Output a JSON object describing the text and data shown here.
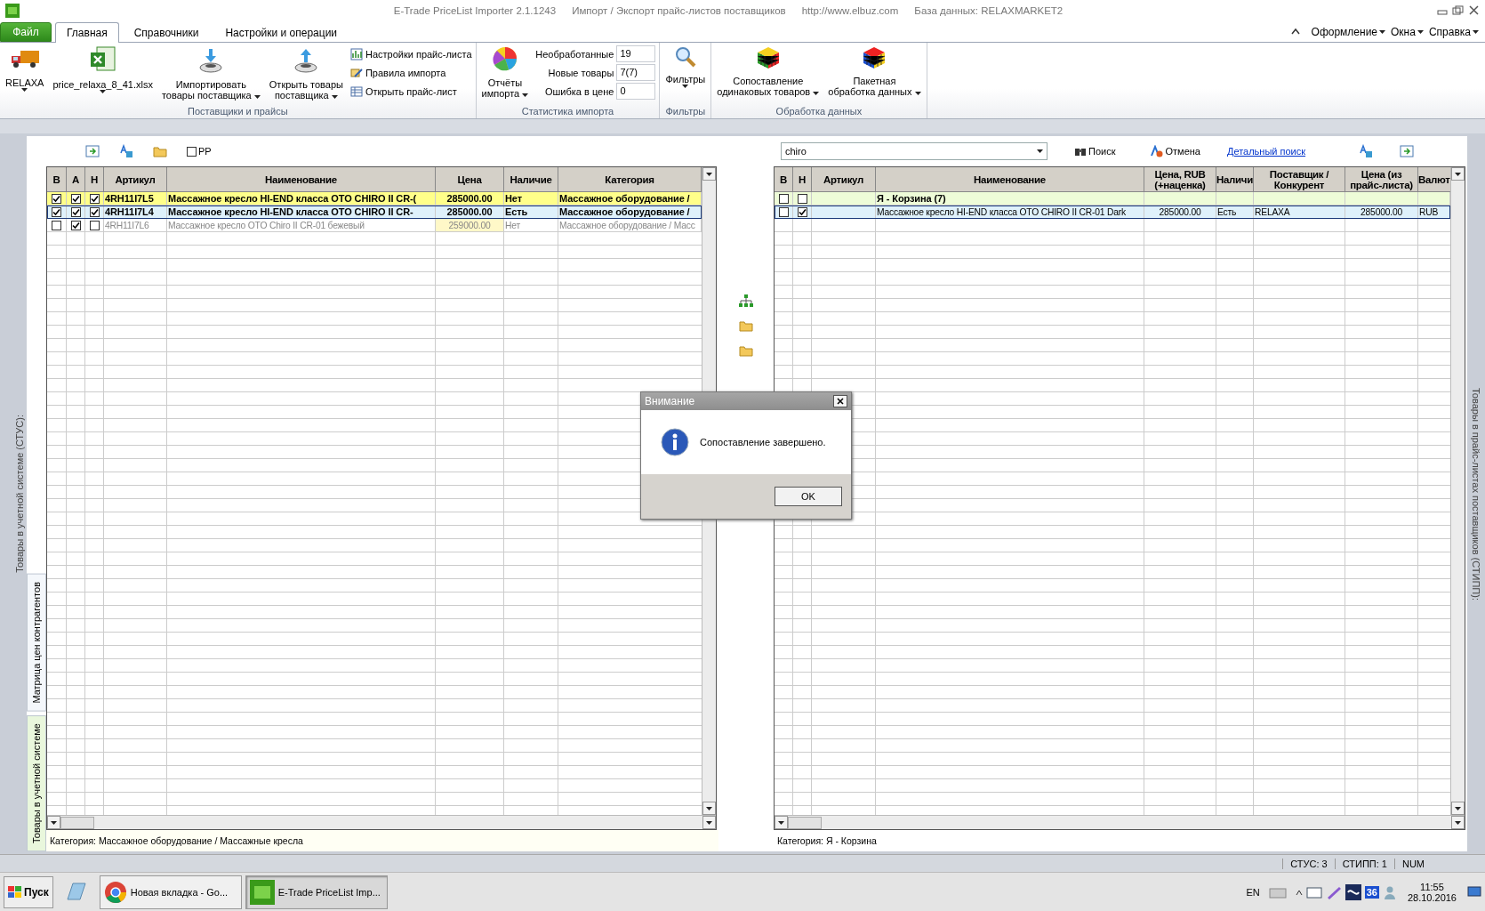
{
  "window": {
    "title_parts": [
      "E-Trade PriceList Importer 2.1.1243",
      "Импорт / Экспорт прайс-листов поставщиков",
      "http://www.elbuz.com",
      "База данных: RELAXMARKET2"
    ]
  },
  "ribbon_tabs": [
    {
      "label": "Файл",
      "kind": "file",
      "selected": false
    },
    {
      "label": "Главная",
      "kind": "tab",
      "selected": true
    },
    {
      "label": "Справочники",
      "kind": "tab",
      "selected": false
    },
    {
      "label": "Настройки и операции",
      "kind": "tab",
      "selected": false
    }
  ],
  "top_menu": [
    {
      "label": "Оформление",
      "dropdown": true
    },
    {
      "label": "Окна",
      "dropdown": true
    },
    {
      "label": "Справка",
      "dropdown": true
    }
  ],
  "ribbon_groups": [
    {
      "title": "Поставщики и прайсы",
      "items": [
        {
          "kind": "large",
          "lines": [
            "RELAXA"
          ],
          "dropdown": true
        },
        {
          "kind": "large",
          "lines": [
            "price_relaxa_8_41.xlsx"
          ],
          "dropdown": true
        },
        {
          "kind": "large",
          "lines": [
            "Импортировать",
            "товары поставщика"
          ],
          "dropdown": true
        },
        {
          "kind": "large",
          "lines": [
            "Открыть товары",
            "поставщика"
          ],
          "dropdown": true
        },
        {
          "kind": "small",
          "lines": [
            "Настройки прайс-листа",
            "Правила импорта",
            "Открыть прайс-лист"
          ]
        }
      ]
    },
    {
      "title": "Статистика импорта",
      "items": [
        {
          "kind": "large",
          "lines": [
            "Отчёты",
            "импорта"
          ],
          "dropdown": true
        },
        {
          "kind": "stats",
          "stats": [
            {
              "label": "Необработанные",
              "value": "19"
            },
            {
              "label": "Новые товары",
              "value": "7(7)"
            },
            {
              "label": "Ошибка в цене",
              "value": "0"
            }
          ]
        }
      ]
    },
    {
      "title": "Фильтры",
      "items": [
        {
          "kind": "large",
          "lines": [
            "Фильтры"
          ],
          "dropdown": true
        }
      ]
    },
    {
      "title": "Обработка данных",
      "items": [
        {
          "kind": "large",
          "lines": [
            "Сопоставление",
            "одинаковых товаров"
          ],
          "dropdown": true
        },
        {
          "kind": "large",
          "lines": [
            "Пакетная",
            "обработка данных"
          ],
          "dropdown": true
        }
      ]
    }
  ],
  "left_caption": "Товары в учетной системе (СТУС):",
  "side_tabs": [
    {
      "label": "Матрица цен контрагентов",
      "selected": false
    },
    {
      "label": "Товары в учетной системе",
      "selected": true
    }
  ],
  "right_caption": "Товары в прайс-листах поставщиков (СТИПП):",
  "left_toolbar": {
    "pp_checkbox": {
      "label": "PP",
      "checked": false
    }
  },
  "search": {
    "value": "chiro",
    "buttons": [
      "Поиск",
      "Отмена"
    ],
    "link": "Детальный поиск"
  },
  "left_table": {
    "check_columns": [
      "В",
      "А",
      "Н"
    ],
    "columns": [
      "Артикул",
      "Наименование",
      "Цена",
      "Наличие",
      "Категория"
    ],
    "rows": [
      {
        "kind": "highlight",
        "selected": false,
        "b": true,
        "a": true,
        "n": true,
        "cells": [
          "4RH11I7L5",
          "Массажное кресло HI-END класса OTO CHIRO II CR-(",
          "285000.00",
          "Нет",
          "Массажное оборудование /"
        ]
      },
      {
        "kind": "highlight",
        "selected": true,
        "b": true,
        "a": true,
        "n": true,
        "cells": [
          "4RH11I7L4",
          "Массажное кресло HI-END класса OTO CHIRO II CR-",
          "285000.00",
          "Есть",
          "Массажное оборудование /"
        ]
      },
      {
        "kind": "inactive",
        "selected": false,
        "b": false,
        "a": true,
        "n": false,
        "cells": [
          "4RH11I7L6",
          "Массажное кресло OTO Chiro II CR-01 бежевый",
          "259000.00",
          "Нет",
          "Массажное оборудование / Масс"
        ]
      }
    ],
    "footer": "Категория: Массажное оборудование / Массажные кресла"
  },
  "right_table": {
    "check_columns": [
      "В",
      "Н"
    ],
    "columns": [
      "Артикул",
      "Наименование",
      "Цена, RUB (+наценка)",
      "Наличи",
      "Поставщик / Конкурент",
      "Цена (из прайс-листа)",
      "Валют"
    ],
    "rows": [
      {
        "kind": "group",
        "selected": false,
        "b": false,
        "n": false,
        "cells": [
          "",
          "Я - Корзина (7)"
        ]
      },
      {
        "kind": "normal",
        "selected": true,
        "b": false,
        "n": true,
        "cells": [
          "",
          "Массажное кресло HI-END класса OTO CHIRO II CR-01 Dark",
          "285000.00",
          "Есть",
          "RELAXA",
          "285000.00",
          "RUB"
        ]
      }
    ],
    "footer": "Категория: Я - Корзина"
  },
  "dialog": {
    "title": "Внимание",
    "message": "Сопоставление завершено.",
    "button": "OK"
  },
  "status_bar": [
    "СТУС: 3",
    "СТИПП: 1",
    "NUM"
  ],
  "taskbar": {
    "start": "Пуск",
    "tasks": [
      {
        "label": "Новая вкладка - Go...",
        "selected": false
      },
      {
        "label": "E-Trade PriceList Imp...",
        "selected": true
      }
    ],
    "lang": "EN",
    "tray_badge": "36",
    "time": "11:55",
    "date": "28.10.2016"
  }
}
